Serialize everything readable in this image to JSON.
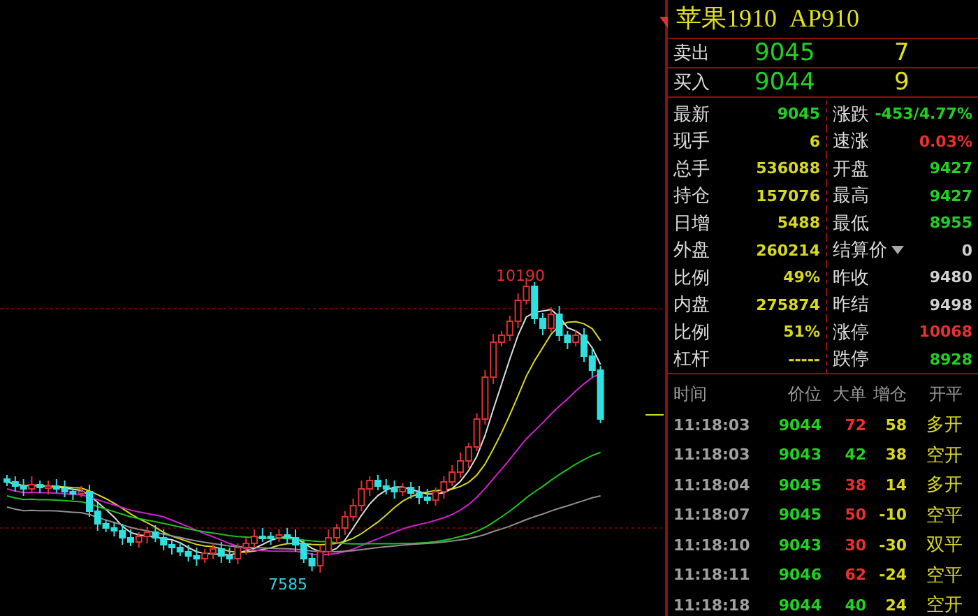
{
  "chart": {
    "high_label": "10190",
    "low_label": "7585"
  },
  "quote": {
    "title": "苹果1910  AP910",
    "orderbook": [
      {
        "label": "卖出",
        "price": "9045",
        "volume": "7"
      },
      {
        "label": "买入",
        "price": "9044",
        "volume": "9"
      }
    ],
    "stats": [
      {
        "left": {
          "label": "最新",
          "value": "9045",
          "color": "#22d022"
        },
        "right": {
          "label": "涨跌",
          "value": "-453/4.77%",
          "color": "#22d022"
        }
      },
      {
        "left": {
          "label": "现手",
          "value": "6",
          "color": "#d8d820"
        },
        "right": {
          "label": "速涨",
          "value": "0.03%",
          "color": "#e83030"
        }
      },
      {
        "left": {
          "label": "总手",
          "value": "536088",
          "color": "#d8d820"
        },
        "right": {
          "label": "开盘",
          "value": "9427",
          "color": "#22d022"
        }
      },
      {
        "left": {
          "label": "持仓",
          "value": "157076",
          "color": "#d8d820"
        },
        "right": {
          "label": "最高",
          "value": "9427",
          "color": "#22d022"
        }
      },
      {
        "left": {
          "label": "日增",
          "value": "5488",
          "color": "#d8d820"
        },
        "right": {
          "label": "最低",
          "value": "8955",
          "color": "#22d022"
        }
      },
      {
        "left": {
          "label": "外盘",
          "value": "260214",
          "color": "#d8d820"
        },
        "right": {
          "label": "结算价",
          "dropdown": true,
          "value": "0",
          "color": "#d0d0d0"
        }
      },
      {
        "left": {
          "label": "比例",
          "value": "49%",
          "color": "#d8d820"
        },
        "right": {
          "label": "昨收",
          "value": "9480",
          "color": "#d0d0d0"
        }
      },
      {
        "left": {
          "label": "内盘",
          "value": "275874",
          "color": "#d8d820"
        },
        "right": {
          "label": "昨结",
          "value": "9498",
          "color": "#d0d0d0"
        }
      },
      {
        "left": {
          "label": "比例",
          "value": "51%",
          "color": "#d8d820"
        },
        "right": {
          "label": "涨停",
          "value": "10068",
          "color": "#e83030"
        }
      },
      {
        "left": {
          "label": "杠杆",
          "value": "-----",
          "color": "#d8d820"
        },
        "right": {
          "label": "跌停",
          "value": "8928",
          "color": "#22d022"
        }
      }
    ],
    "trade_columns": [
      "时间",
      "价位",
      "大单",
      "增仓",
      "开平"
    ],
    "trades": [
      {
        "time": "11:18:03",
        "price": "9044",
        "big": {
          "value": "72",
          "color": "#e83030"
        },
        "change": "58",
        "type": "多开"
      },
      {
        "time": "11:18:03",
        "price": "9043",
        "big": {
          "value": "42",
          "color": "#22d022"
        },
        "change": "38",
        "type": "空开"
      },
      {
        "time": "11:18:04",
        "price": "9045",
        "big": {
          "value": "38",
          "color": "#e83030"
        },
        "change": "14",
        "type": "多开"
      },
      {
        "time": "11:18:07",
        "price": "9045",
        "big": {
          "value": "50",
          "color": "#e83030"
        },
        "change": "-10",
        "type": "空平"
      },
      {
        "time": "11:18:10",
        "price": "9043",
        "big": {
          "value": "30",
          "color": "#e83030"
        },
        "change": "-30",
        "type": "双平"
      },
      {
        "time": "11:18:11",
        "price": "9046",
        "big": {
          "value": "62",
          "color": "#e83030"
        },
        "change": "-24",
        "type": "空平"
      },
      {
        "time": "11:18:18",
        "price": "9044",
        "big": {
          "value": "40",
          "color": "#22d022"
        },
        "change": "24",
        "type": "空开"
      }
    ]
  }
}
